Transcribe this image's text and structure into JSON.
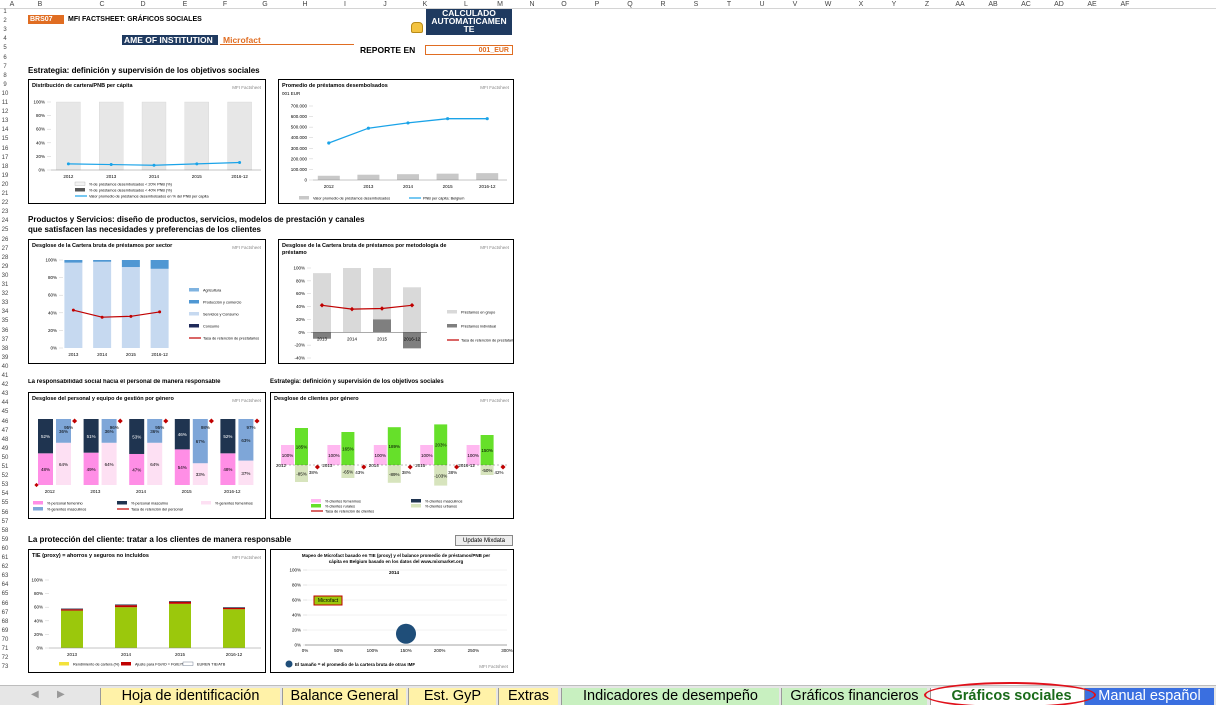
{
  "sheet": {
    "code": "BRS07",
    "title": "MFI FACTSHEET: GRÁFICOS SOCIALES"
  },
  "columns": [
    "A",
    "B",
    "C",
    "D",
    "E",
    "F",
    "G",
    "H",
    "I",
    "J",
    "K",
    "L",
    "M",
    "N",
    "O",
    "P",
    "Q",
    "R",
    "S",
    "T",
    "U",
    "V",
    "W",
    "X",
    "Y",
    "Z",
    "AA",
    "AB",
    "AC",
    "AD",
    "AE",
    "AF"
  ],
  "rows": [
    "1",
    "2",
    "3",
    "4",
    "5",
    "6",
    "7",
    "8",
    "9",
    "10",
    "11",
    "12",
    "13",
    "14",
    "15",
    "16",
    "17",
    "18",
    "19",
    "20",
    "21",
    "22",
    "23",
    "24",
    "25",
    "26",
    "27",
    "28",
    "29",
    "30",
    "31",
    "32",
    "33",
    "34",
    "35",
    "36",
    "37",
    "38",
    "39",
    "40",
    "41",
    "42",
    "43",
    "44",
    "45",
    "46",
    "47",
    "48",
    "49",
    "50",
    "51",
    "52",
    "53",
    "54",
    "55",
    "56",
    "57",
    "58",
    "59",
    "60",
    "61",
    "62",
    "63",
    "64",
    "65",
    "66",
    "67",
    "68",
    "69",
    "70",
    "71",
    "72",
    "73"
  ],
  "header": {
    "calc_line1": "CALCULADO",
    "calc_line2": "AUTOMATICAMEN",
    "calc_line3": "TE",
    "institution_label": "AME OF INSTITUTION",
    "institution_value": "Microfact",
    "report_label": "REPORTE EN",
    "report_value": "001_EUR"
  },
  "sections": {
    "s1": "Estrategia: definición y supervisión de los objetivos sociales",
    "s2a": "Productos y Servicios: diseño de productos, servicios, modelos de prestación y canales",
    "s2b": "que satisfacen las necesidades y preferencias de los clientes",
    "s3a": "La responsabilidad social hacia el personal de manera responsable",
    "s3b": "Estrategia: definición y supervisión de los objetivos sociales",
    "s4": "La protección del cliente: tratar a los clientes de manera responsable"
  },
  "update_button": "Update Mixdata",
  "watermark": "MFI Factsheet",
  "chart_data": [
    {
      "id": "c1",
      "type": "line",
      "title": "Distribución de cartera/PNB per cápita",
      "categories": [
        "2012",
        "2013",
        "2014",
        "2015",
        "2016-12"
      ],
      "series": [
        {
          "name": "% de préstamos desembolsados < 20% PNB (%)",
          "values": [
            0,
            0,
            0,
            0,
            0
          ]
        },
        {
          "name": "% de préstamos desembolsados < 40% PNB (%)",
          "values": [
            0,
            0,
            0,
            0,
            0
          ]
        },
        {
          "name": "Valor promedio de préstamos desembolsados en % del PNB per capita",
          "values": [
            9,
            8,
            7,
            9,
            11
          ]
        }
      ],
      "yticks": [
        "100%",
        "80%",
        "60%",
        "40%",
        "20%",
        "0%"
      ],
      "ylim": [
        0,
        100
      ]
    },
    {
      "id": "c2",
      "type": "bar+line",
      "title": "Promedio de préstamos desembolsados",
      "unit": "001 EUR",
      "categories": [
        "2012",
        "2013",
        "2014",
        "2015",
        "2016-12"
      ],
      "series": [
        {
          "name": "Valor promedio de préstamos desembolsados",
          "values": [
            40000,
            50000,
            55000,
            60000,
            65000
          ]
        },
        {
          "name": "PNB per cápita: Belgium",
          "values": [
            350000,
            490000,
            540000,
            580000,
            580000
          ]
        }
      ],
      "yticks": [
        "700.000",
        "600.000",
        "500.000",
        "400.000",
        "300.000",
        "200.000",
        "100.000",
        "0"
      ],
      "ylim": [
        0,
        700000
      ]
    },
    {
      "id": "c3",
      "type": "stacked-bar+line",
      "title": "Desglose de la Cartera bruta de préstamos por sector",
      "categories": [
        "2013",
        "2014",
        "2015",
        "2016-12"
      ],
      "series": [
        {
          "name": "Agricultura",
          "values": [
            0,
            0,
            0,
            0
          ]
        },
        {
          "name": "Producción y comercio",
          "values": [
            3,
            2,
            8,
            10
          ]
        },
        {
          "name": "Servicios y Consumo",
          "values": [
            97,
            98,
            92,
            90
          ]
        },
        {
          "name": "Consumo",
          "values": [
            0,
            0,
            0,
            0
          ]
        },
        {
          "name": "Tasa de retención de prestatarios",
          "values": [
            43,
            35,
            36,
            41
          ]
        }
      ],
      "yticks": [
        "100%",
        "80%",
        "60%",
        "40%",
        "20%",
        "0%"
      ]
    },
    {
      "id": "c4",
      "type": "stacked-bar+line",
      "title": "Desglose de la Cartera bruta de préstamos por metodología de préstamo",
      "categories": [
        "2013",
        "2014",
        "2015",
        "2016-12"
      ],
      "series": [
        {
          "name": "Préstamos en grupo",
          "values": [
            92,
            100,
            100,
            70
          ]
        },
        {
          "name": "Préstamos individual",
          "values": [
            -10,
            0,
            20,
            -25
          ]
        },
        {
          "name": "Tasa de retención de prestatarios",
          "values": [
            42,
            36,
            37,
            42
          ]
        }
      ],
      "yticks": [
        "100%",
        "80%",
        "60%",
        "40%",
        "20%",
        "0%",
        "-20%",
        "-40%"
      ]
    },
    {
      "id": "c5",
      "type": "stacked-bar",
      "title": "Desglose del personal y equipo de gestión por género",
      "categories": [
        "2012",
        "2013",
        "2014",
        "2015",
        "2016-12"
      ],
      "series": [
        {
          "name": "% personal femenino",
          "values": [
            48,
            49,
            47,
            54,
            48
          ]
        },
        {
          "name": "% personal masculino",
          "values": [
            52,
            51,
            53,
            46,
            52
          ]
        },
        {
          "name": "% gerentes femeninos",
          "values": [
            64,
            64,
            64,
            33,
            37
          ]
        },
        {
          "name": "% gerentes masculinos",
          "values": [
            36,
            36,
            36,
            67,
            63
          ]
        },
        {
          "name": "Tasa de retención del personal",
          "values": [
            95,
            96,
            95,
            98,
            97
          ]
        }
      ],
      "labels": [
        "52%",
        "36%",
        "95%",
        "51%",
        "36%",
        "96%",
        "53%",
        "36%",
        "95%",
        "46%",
        "67%",
        "98%",
        "52%",
        "63%",
        "97%",
        "48%",
        "64%",
        "49%",
        "64%",
        "47%",
        "64%",
        "54%",
        "33%",
        "48%",
        "37%"
      ]
    },
    {
      "id": "c6",
      "type": "stacked-bar",
      "title": "Desglose de clientes por género",
      "categories": [
        "2012",
        "2013",
        "2014",
        "2015",
        "2016-12"
      ],
      "series": [
        {
          "name": "% clientes femeninos",
          "values": [
            100,
            100,
            100,
            100,
            100
          ]
        },
        {
          "name": "% clientes masculinos",
          "values": [
            0,
            0,
            0,
            0,
            0
          ]
        },
        {
          "name": "% clientes rurales",
          "values": [
            185,
            165,
            189,
            203,
            150
          ]
        },
        {
          "name": "% clientes urbanos",
          "values": [
            -85,
            -65,
            -89,
            -103,
            -50
          ]
        },
        {
          "name": "Tasa de retención de clientes",
          "values": [
            38,
            43,
            38,
            38,
            42
          ]
        }
      ],
      "labels": [
        "185%",
        "100%",
        "165%",
        "100%",
        "189%",
        "100%",
        "203%",
        "100%",
        "150%",
        "100%",
        "-85%",
        "-65%",
        "-89%",
        "-103%",
        "-50%",
        "43%",
        "38%",
        "38%",
        "42%"
      ]
    },
    {
      "id": "c7",
      "type": "stacked-bar",
      "title": "TIE (proxy) = ahorros y seguros no incluidos",
      "categories": [
        "2013",
        "2014",
        "2015",
        "2016-12"
      ],
      "series": [
        {
          "name": "Rendimiento de cartera (%)",
          "values": [
            55,
            60,
            65,
            57
          ]
        },
        {
          "name": "Ajuste para FGI/IO = FGIE/TIC",
          "values": [
            2,
            3,
            3,
            2
          ]
        },
        {
          "name": "EUREN TIE/ATB",
          "values": [
            1,
            1,
            1,
            1
          ]
        }
      ],
      "yticks": [
        "100%",
        "80%",
        "60%",
        "40%",
        "20%",
        "0%"
      ]
    },
    {
      "id": "c8",
      "type": "scatter",
      "title": "Mapeo de Microfact basado en TIE (proxy) y el balance promedio de préstamos/PNB per cápita en Belgium basado en los datos del www.mixmarket.org",
      "year": "2014",
      "points": [
        {
          "label": "Microfact",
          "x": 0,
          "y": 60
        },
        {
          "label": "",
          "x": 150,
          "y": 15
        }
      ],
      "xticks": [
        "0%",
        "50%",
        "100%",
        "150%",
        "200%",
        "250%",
        "300%"
      ],
      "yticks": [
        "100%",
        "80%",
        "60%",
        "40%",
        "20%",
        "0%"
      ],
      "note": "El tamaño = el promedio de la cartera bruta de otras IMF"
    }
  ],
  "legend_labels": {
    "c1": [
      "% de préstamos desembolsados < 20% PNB (%)",
      "% de préstamos desembolsados < 40% PNB (%)",
      "Valor promedio de préstamos desembolsados en % del PNB per capita"
    ],
    "c2": [
      "Valor promedio de préstamos desembolsados",
      "PNB per cápita: Belgium"
    ],
    "c3": [
      "Agricultura",
      "Producción y comercio",
      "Servicios y Consumo",
      "Consumo",
      "Tasa de retención de prestatarios"
    ],
    "c4": [
      "Préstamos en grupo",
      "Préstamos individual",
      "Tasa de retención de prestatarios"
    ],
    "c5": [
      "% personal femenino",
      "% personal masculino",
      "% gerentes femeninos",
      "% gerentes masculinos",
      "Tasa de retención del personal"
    ],
    "c6": [
      "% clientes femeninos",
      "% clientes masculinos",
      "% clientes rurales",
      "% clientes urbanos",
      "Tasa de retención de clientes"
    ],
    "c7": [
      "Rendimiento de cartera (%)",
      "Ajuste para FGI/IO = FGIE/TIC",
      "EUREN TIE/ATB"
    ]
  },
  "tabs": [
    {
      "label": "Hoja de identificación",
      "bg": "#fff2a8"
    },
    {
      "label": "Balance General",
      "bg": "#fff2a8"
    },
    {
      "label": "Est. GyP",
      "bg": "#fff2a8"
    },
    {
      "label": "Extras",
      "bg": "#fff2a8"
    },
    {
      "label": "Indicadores de desempeño",
      "bg": "#c8f0c0"
    },
    {
      "label": "Gráficos financieros",
      "bg": "#c8f0c0"
    },
    {
      "label": "Gráficos sociales",
      "bg": "#ffffff"
    },
    {
      "label": "Manual español",
      "bg": "#3a6fe0"
    }
  ]
}
